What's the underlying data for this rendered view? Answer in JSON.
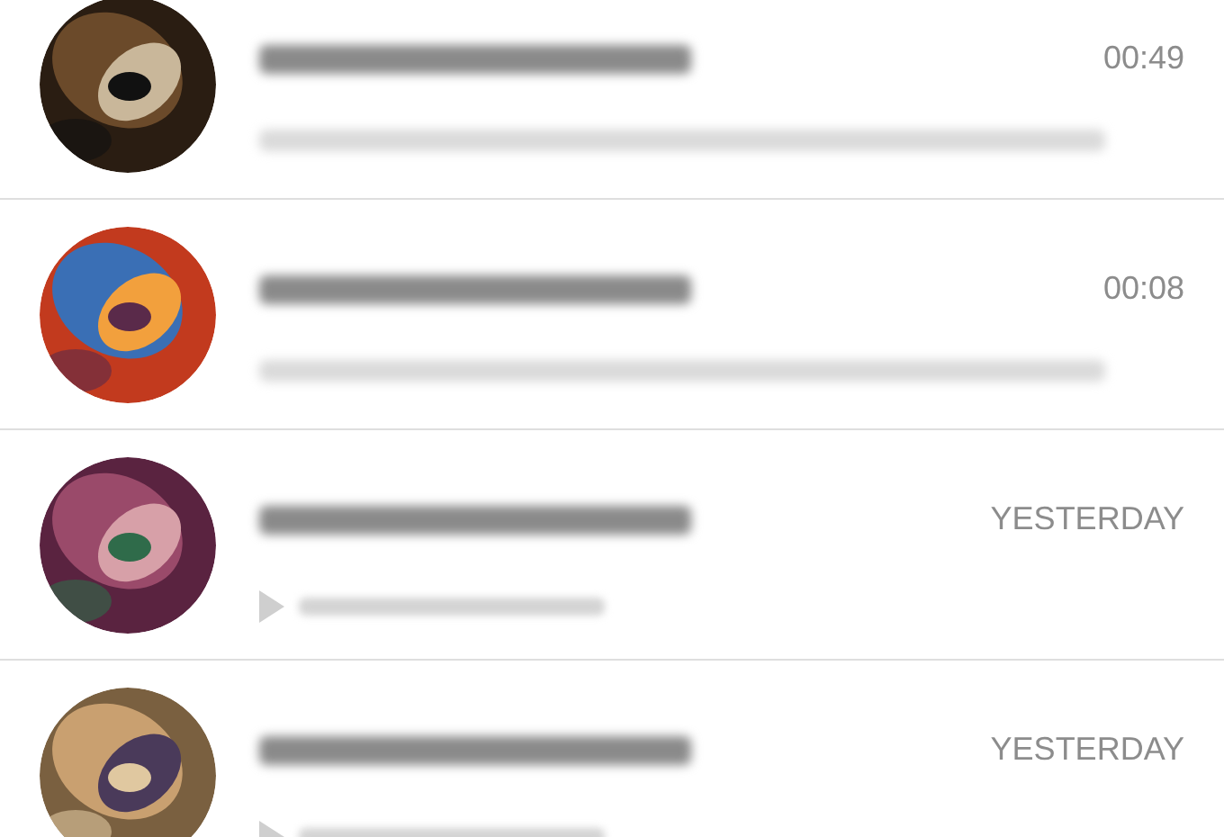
{
  "conversations": [
    {
      "time": "00:49",
      "kind": "text"
    },
    {
      "time": "00:08",
      "kind": "text"
    },
    {
      "time": "YESTERDAY",
      "kind": "voice"
    },
    {
      "time": "YESTERDAY",
      "kind": "voice"
    }
  ]
}
